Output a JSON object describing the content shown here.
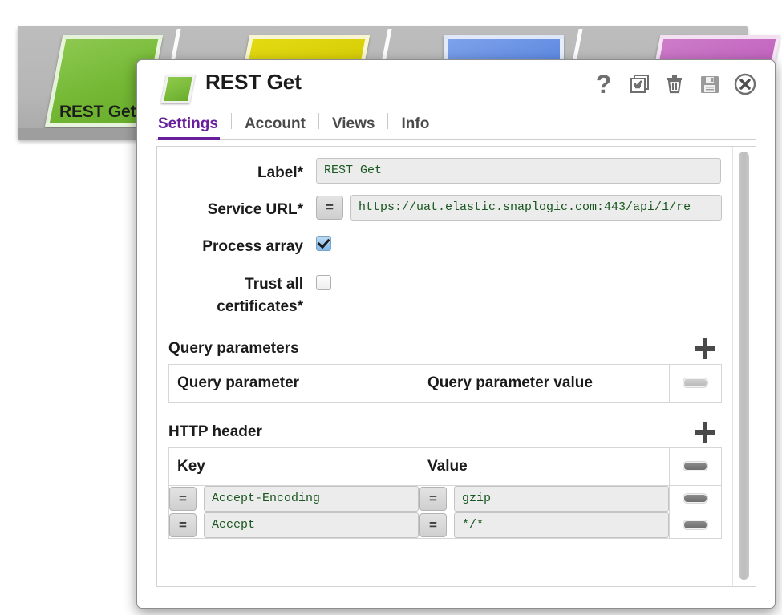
{
  "canvas": {
    "snaps": [
      {
        "name": "REST Get",
        "color": "#7cc043",
        "shape": "parallelogram"
      },
      {
        "name": "",
        "color": "#dbd109",
        "shape": "parallelogram"
      },
      {
        "name": "",
        "color": "#5a86e0",
        "shape": "rectangle"
      },
      {
        "name": "",
        "color": "#c061bd",
        "shape": "parallelogram"
      }
    ],
    "label": "REST Get"
  },
  "dialog": {
    "title": "REST Get",
    "icon": "snap-green-icon",
    "tools": [
      {
        "name": "help-icon",
        "label": "?"
      },
      {
        "name": "restore-icon",
        "label": ""
      },
      {
        "name": "delete-icon",
        "label": ""
      },
      {
        "name": "save-icon",
        "label": ""
      },
      {
        "name": "close-icon",
        "label": ""
      }
    ],
    "tabs": [
      {
        "label": "Settings",
        "active": true
      },
      {
        "label": "Account",
        "active": false
      },
      {
        "label": "Views",
        "active": false
      },
      {
        "label": "Info",
        "active": false
      }
    ],
    "accent_color": "#671f9b"
  },
  "settings": {
    "label_field": {
      "label": "Label*",
      "value": "REST Get"
    },
    "service_url": {
      "label": "Service URL*",
      "expr_toggle": "=",
      "value": "https://uat.elastic.snaplogic.com:443/api/1/re"
    },
    "process_array": {
      "label": "Process array",
      "checked": true
    },
    "trust_certs": {
      "label": "Trust all certificates*",
      "checked": false
    }
  },
  "query_parameters": {
    "title": "Query parameters",
    "add_label": "+",
    "remove_label": "−",
    "headers": [
      "Query parameter",
      "Query parameter value"
    ],
    "rows": []
  },
  "http_header": {
    "title": "HTTP header",
    "add_label": "+",
    "remove_label": "−",
    "headers": [
      "Key",
      "Value"
    ],
    "rows": [
      {
        "key_toggle": "=",
        "key": "Accept-Encoding",
        "value_toggle": "=",
        "value": "gzip"
      },
      {
        "key_toggle": "=",
        "key": "Accept",
        "value_toggle": "=",
        "value": "*/*"
      }
    ]
  }
}
